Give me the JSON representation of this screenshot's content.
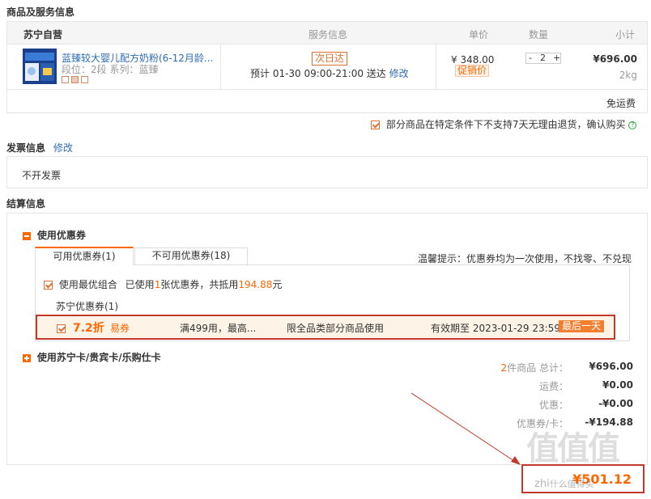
{
  "goods_section": {
    "title": "商品及服务信息",
    "store_name": "苏宁自营",
    "headers": {
      "service": "服务信息",
      "price": "单价",
      "qty": "数量",
      "subtotal": "小计"
    },
    "product": {
      "name": "蓝臻较大婴儿配方奶粉(6-12月龄...",
      "spec": "段位：2段  系列：蓝臻",
      "badge": "次日达",
      "delivery_prefix": "预计 01-30  09:00-21:00 送达",
      "modify": "修改",
      "price": "¥ 348.00",
      "promo": "促销价",
      "qty_minus": "-",
      "qty_value": "2",
      "qty_plus": "+",
      "subtotal": "¥696.00",
      "weight": "2kg"
    },
    "freight": "免运费",
    "return_notice": "部分商品在特定条件下不支持7天无理由退货，确认购买",
    "help_icon": "?"
  },
  "invoice_section": {
    "title": "发票信息",
    "modify": "修改",
    "value": "不开发票"
  },
  "settle_section": {
    "title": "结算信息",
    "coupon_toggle_label": "使用优惠券",
    "tabs": [
      {
        "label": "可用优惠券(1)"
      },
      {
        "label": "不可用优惠券(18)"
      }
    ],
    "tip": "温馨提示：优惠券均为一次使用，不找零、不兑现",
    "best_combo": {
      "label": "使用最优组合",
      "used_prefix": "已使用",
      "used_count": "1",
      "used_mid": "张优惠券，共抵用",
      "used_amount": "194.88",
      "used_suffix": "元"
    },
    "coupon_group": "苏宁优惠券(1)",
    "coupon": {
      "discount": "7.2折",
      "type": "易券",
      "condition": "满499用，最高...",
      "scope": "限全品类部分商品使用",
      "expiry": "有效期至 2023-01-29 23:59",
      "tag": "最后一天"
    },
    "card_toggle_label": "使用苏宁卡/贵宾卡/乐购仕卡"
  },
  "summary": {
    "rows": [
      {
        "count": "2",
        "label": "件商品 总计：",
        "value": "¥696.00"
      },
      {
        "label": "运费：",
        "value": "¥0.00"
      },
      {
        "label": "优惠：",
        "value": "-¥0.00"
      },
      {
        "label": "优惠券/卡：",
        "value": "-¥194.88"
      }
    ],
    "total_value": "¥501.12"
  },
  "watermark": "什么值得买",
  "colors": {
    "accent": "#ff6600",
    "link": "#2f6db5",
    "highlight_border": "#c0392b",
    "coupon_bg": "#fdf3e6"
  }
}
